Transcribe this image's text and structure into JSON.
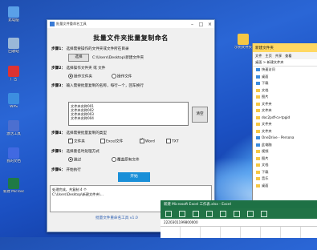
{
  "desktop": {
    "icons": [
      {
        "label": "此电脑",
        "color": "#5aa0e8"
      },
      {
        "label": "回收站",
        "color": "#9ab8d8"
      },
      {
        "label": "广告",
        "color": "#d33"
      },
      {
        "label": "WPS",
        "color": "#3c8ee0"
      },
      {
        "label": "激活工具",
        "color": "#4c6fd0"
      },
      {
        "label": "我的文档",
        "color": "#4169e1"
      },
      {
        "label": "新建 Microsoft Excel 工作表",
        "color": "#1f7a45"
      }
    ],
    "right_icon": {
      "label": "示例文件夹"
    }
  },
  "dialog": {
    "title": "批量文件重命名工具",
    "heading": "批量文件夹批量复制命名",
    "step1_label": "步骤1：",
    "step1_text": "选择需要操作的文件夹或文件所在目录",
    "select_btn": "选择",
    "path_value": "C:\\Users\\Desktop\\新建文件夹",
    "step2_label": "步骤2：",
    "step2_text": "选择操作文件夹 或 文件",
    "opt_folder": "操作文件夹",
    "opt_file": "操作文件",
    "step3_label": "步骤3：",
    "step3_text": "输入需要批量复制的名称，每行一个，回车换行",
    "textarea_lines": [
      "文件夹名称001",
      "文件夹名称002",
      "文件夹名称003",
      "文件夹名称004"
    ],
    "clear_btn": "清空",
    "step4_label": "步骤4：",
    "step4_text": "选择需要批量复制的类型",
    "cb_a": "文件夹",
    "cb_b": "Excel文件",
    "cb_c": "Word",
    "cb_d": "TXT",
    "step5_label": "步骤5：",
    "step5_text": "选择重名时处理方式",
    "opt_skip": "跳过",
    "opt_overwrite": "覆盖原有文件",
    "step6_label": "步骤6：",
    "step6_text": "开始执行",
    "run_btn": "开始",
    "log_lines": [
      "处理完成，共复制 4 个",
      "C:\\Users\\Desktop\\新建文件夹\\..."
    ],
    "footer": "批量文件重命名工具 v1.0"
  },
  "explorer": {
    "title": "新建文件夹",
    "ribbon": [
      "文件",
      "主页",
      "共享",
      "查看"
    ],
    "address": "桌面 > 新建文件夹",
    "items": [
      {
        "label": "快速访问",
        "blue": true
      },
      {
        "label": "桌面",
        "blue": true
      },
      {
        "label": "下载",
        "blue": true
      },
      {
        "label": "文档",
        "blue": false
      },
      {
        "label": "图片",
        "blue": false
      },
      {
        "label": "文件夹",
        "blue": false
      },
      {
        "label": "文件夹",
        "blue": false
      },
      {
        "label": "doc2pdf-cv-tpgid",
        "blue": false
      },
      {
        "label": "文件夹",
        "blue": false
      },
      {
        "label": "文件夹",
        "blue": false
      },
      {
        "label": "OneDrive - Persona",
        "blue": true
      },
      {
        "label": "此电脑",
        "blue": true
      },
      {
        "label": "视频",
        "blue": false
      },
      {
        "label": "图片",
        "blue": false
      },
      {
        "label": "文档",
        "blue": false
      },
      {
        "label": "下载",
        "blue": false
      },
      {
        "label": "音乐",
        "blue": false
      },
      {
        "label": "桌面",
        "blue": false
      }
    ]
  },
  "excel": {
    "title": "新建 Microsoft Excel 工作表.xlsx - Excel",
    "formula": "2220301199800000"
  }
}
